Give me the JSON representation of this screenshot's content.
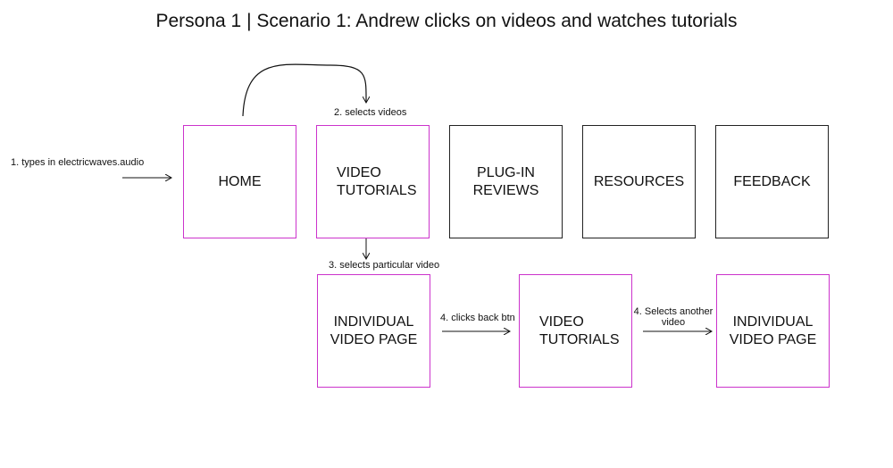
{
  "title": "Persona 1 | Scenario 1: Andrew clicks on videos and watches tutorials",
  "colors": {
    "visited": "#cc33cc",
    "default": "#222222"
  },
  "nodes": {
    "home": "HOME",
    "video_tutorials": "VIDEO\nTUTORIALS",
    "plugin_reviews": "PLUG-IN REVIEWS",
    "resources": "RESOURCES",
    "feedback": "FEEDBACK",
    "individual_video_1": "INDIVIDUAL\nVIDEO PAGE",
    "video_tutorials_2": "VIDEO\nTUTORIALS",
    "individual_video_2": "INDIVIDUAL\nVIDEO PAGE"
  },
  "steps": {
    "s1": "1. types in electricwaves.audio",
    "s2": "2. selects videos",
    "s3": "3. selects particular video",
    "s4a": "4. clicks back btn",
    "s4b": "4. Selects another\nvideo"
  }
}
